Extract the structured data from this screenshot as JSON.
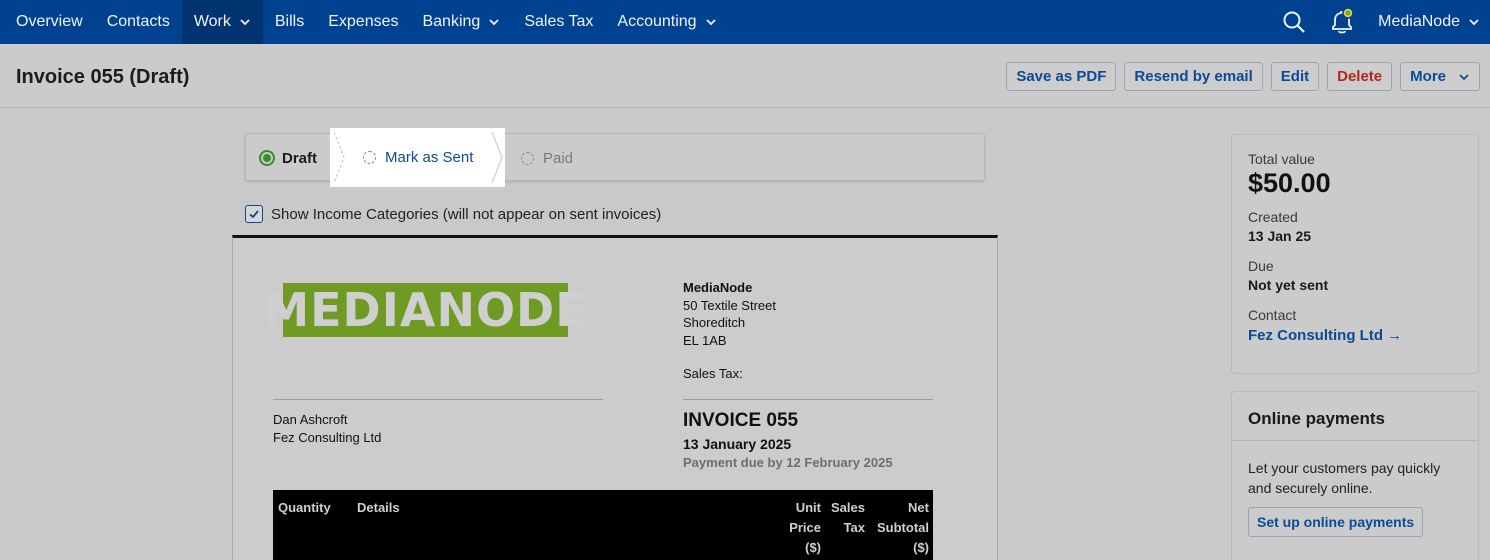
{
  "nav": {
    "items": [
      {
        "label": "Overview",
        "dropdown": false,
        "active": false
      },
      {
        "label": "Contacts",
        "dropdown": false,
        "active": false
      },
      {
        "label": "Work",
        "dropdown": true,
        "active": true
      },
      {
        "label": "Bills",
        "dropdown": false,
        "active": false
      },
      {
        "label": "Expenses",
        "dropdown": false,
        "active": false
      },
      {
        "label": "Banking",
        "dropdown": true,
        "active": false
      },
      {
        "label": "Sales Tax",
        "dropdown": false,
        "active": false
      },
      {
        "label": "Accounting",
        "dropdown": true,
        "active": false
      }
    ],
    "user": "MediaNode",
    "icons": [
      "search-icon",
      "bell-icon",
      "chevron-down-icon"
    ]
  },
  "header": {
    "title": "Invoice 055 (Draft)",
    "actions": {
      "save_pdf": "Save as PDF",
      "resend": "Resend by email",
      "edit": "Edit",
      "delete": "Delete",
      "more": "More"
    }
  },
  "stepper": {
    "draft": "Draft",
    "sent": "Mark as Sent",
    "paid": "Paid"
  },
  "options": {
    "show_income_categories": "Show Income Categories (will not appear on sent invoices)",
    "checked": true
  },
  "invoice": {
    "logo_text": "MEDIANODE",
    "from": {
      "name": "MediaNode",
      "address": [
        "50 Textile Street",
        "Shoreditch",
        "EL 1AB"
      ],
      "sales_tax": "Sales Tax:"
    },
    "to": [
      "Dan Ashcroft",
      "Fez Consulting Ltd"
    ],
    "title": "INVOICE 055",
    "date": "13 January 2025",
    "due": "Payment due by 12 February 2025",
    "columns": {
      "quantity": "Quantity",
      "details": "Details",
      "unit_price": [
        "Unit",
        "Price",
        "($)"
      ],
      "sales_tax": [
        "Sales",
        "Tax"
      ],
      "net_subtotal": [
        "Net",
        "Subtotal",
        "($)"
      ]
    }
  },
  "summary": {
    "total_label": "Total value",
    "total": "$50.00",
    "created_label": "Created",
    "created": "13 Jan 25",
    "due_label": "Due",
    "due": "Not yet sent",
    "contact_label": "Contact",
    "contact": "Fez Consulting Ltd →"
  },
  "payments": {
    "title": "Online payments",
    "text": "Let your customers pay quickly and securely online.",
    "button": "Set up online payments"
  },
  "colors": {
    "nav_bg": "#00428f",
    "link": "#0b4a96",
    "danger": "#b3261e",
    "logo_green": "#6f9a24",
    "done_green": "#3a8a2e"
  }
}
